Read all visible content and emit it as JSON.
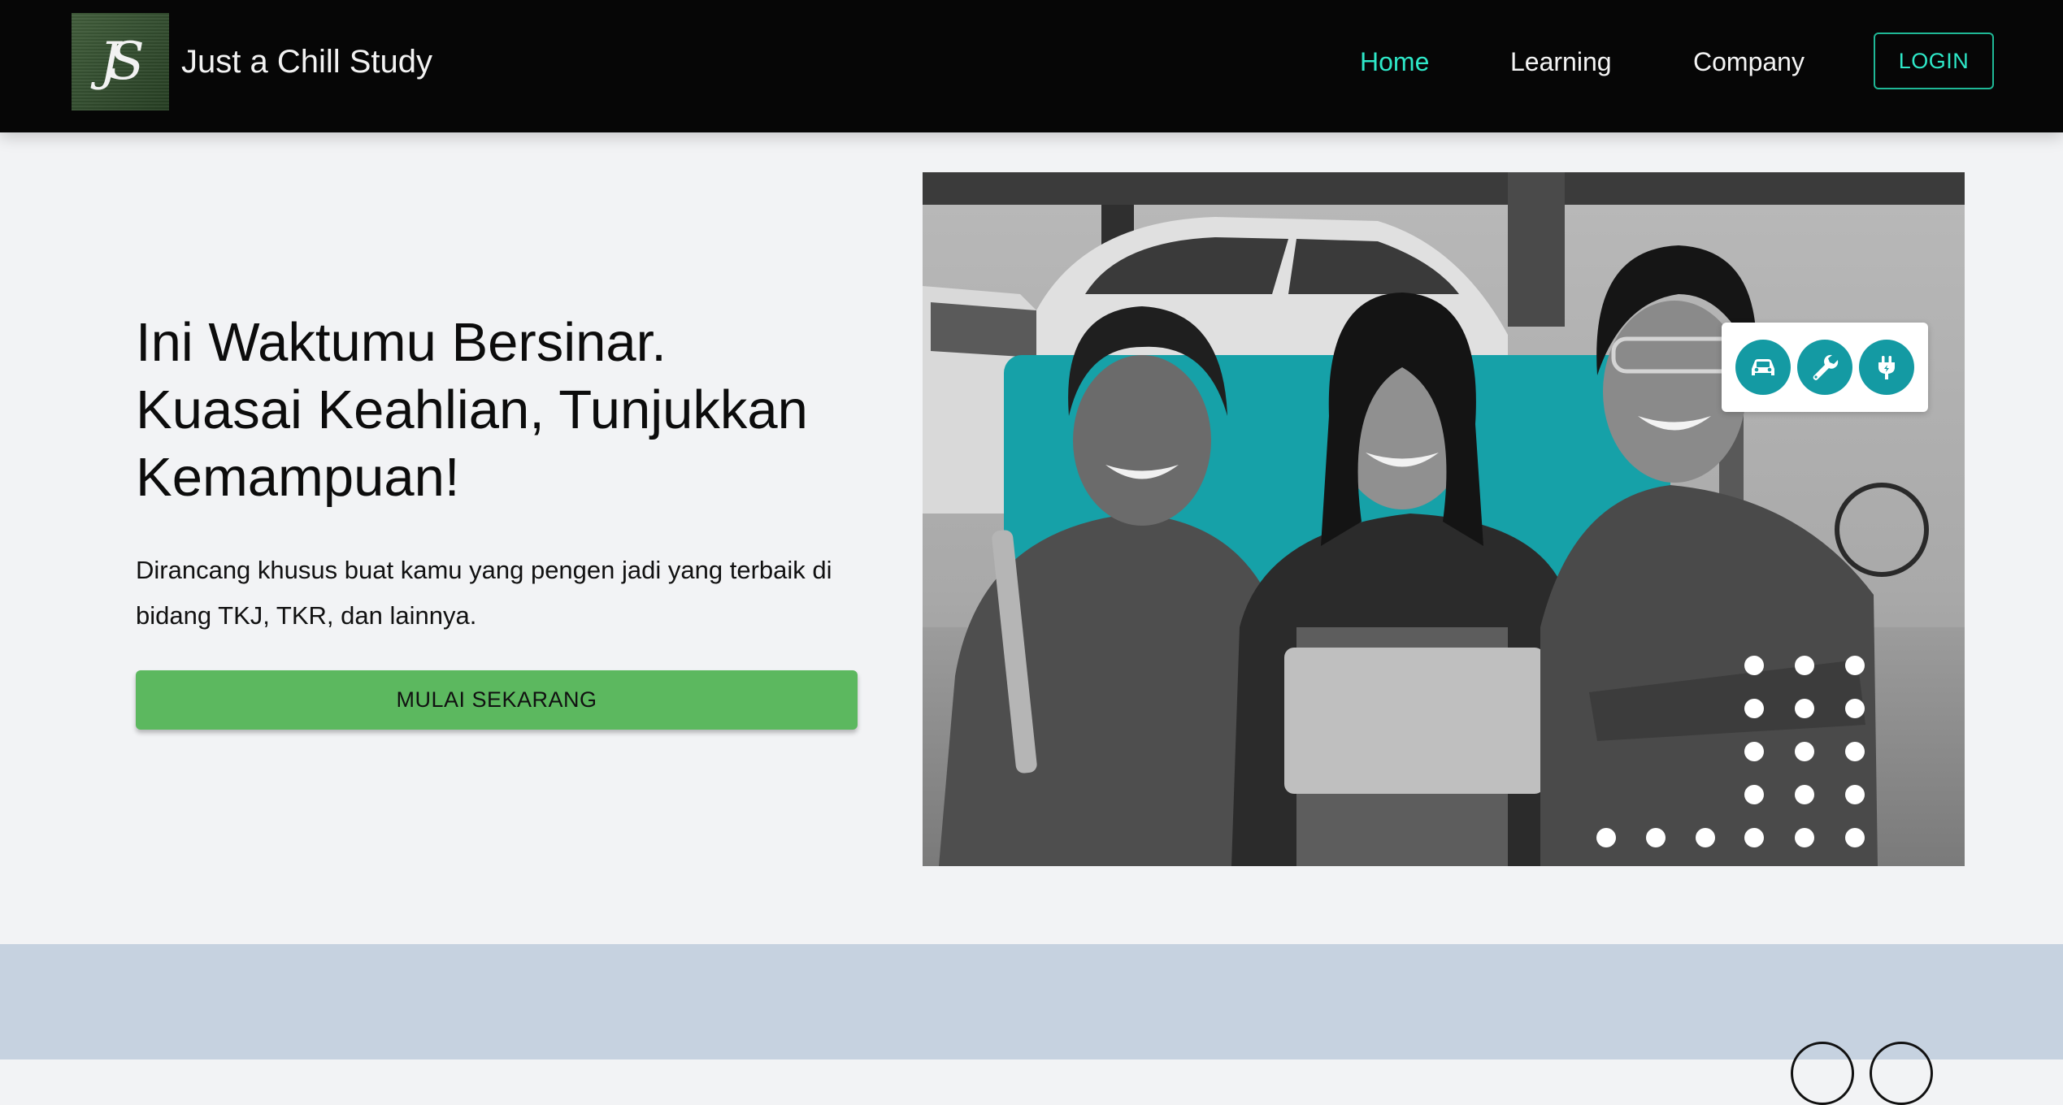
{
  "navbar": {
    "logo_text": "JS",
    "brand": "Just a Chill Study",
    "links": [
      {
        "label": "Home",
        "active": true
      },
      {
        "label": "Learning",
        "active": false
      },
      {
        "label": "Company",
        "active": false
      }
    ],
    "login_label": "LOGIN",
    "accent_color": "#2ee8c8"
  },
  "hero": {
    "title_lines": [
      "Ini Waktumu Bersinar.",
      "Kuasai Keahlian, Tunjukkan",
      "Kemampuan!"
    ],
    "description_lines": [
      "Dirancang khusus buat kamu yang pengen jadi yang terbaik di",
      "bidang TKJ, TKR, dan lainnya."
    ],
    "cta_label": "MULAI SEKARANG",
    "cta_color": "#5cb85f"
  },
  "hero_image": {
    "subject": "three smiling students in workshop attire",
    "badge_icons": [
      "car-icon",
      "wrench-icon",
      "plug-icon"
    ],
    "badge_icon_color": "#149aa3"
  },
  "bottom_section": {
    "background": "#c6d2e0",
    "carousel_controls": [
      "prev-circle",
      "next-circle"
    ]
  }
}
